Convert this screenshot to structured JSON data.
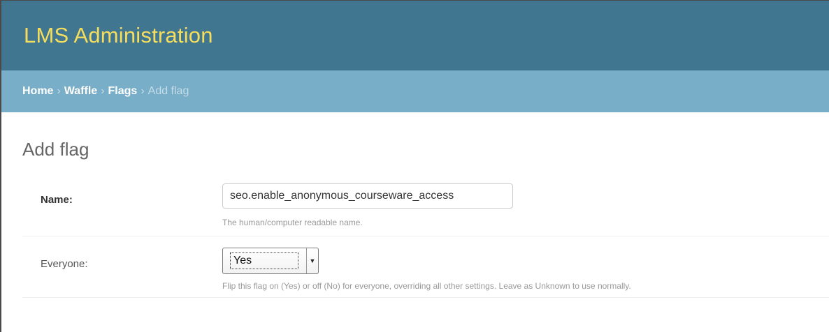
{
  "header": {
    "site_title": "LMS Administration"
  },
  "breadcrumbs": {
    "items": [
      {
        "label": "Home"
      },
      {
        "label": "Waffle"
      },
      {
        "label": "Flags"
      }
    ],
    "separator": "›",
    "current": "Add flag"
  },
  "page": {
    "title": "Add flag"
  },
  "form": {
    "name": {
      "label": "Name:",
      "value": "seo.enable_anonymous_courseware_access",
      "help": "The human/computer readable name."
    },
    "everyone": {
      "label": "Everyone:",
      "selected": "Yes",
      "help": "Flip this flag on (Yes) or off (No) for everyone, overriding all other settings. Leave as Unknown to use normally."
    }
  },
  "colors": {
    "header_bg": "#417690",
    "site_title": "#f5dd5d",
    "breadcrumb_bg": "#79aec8"
  }
}
